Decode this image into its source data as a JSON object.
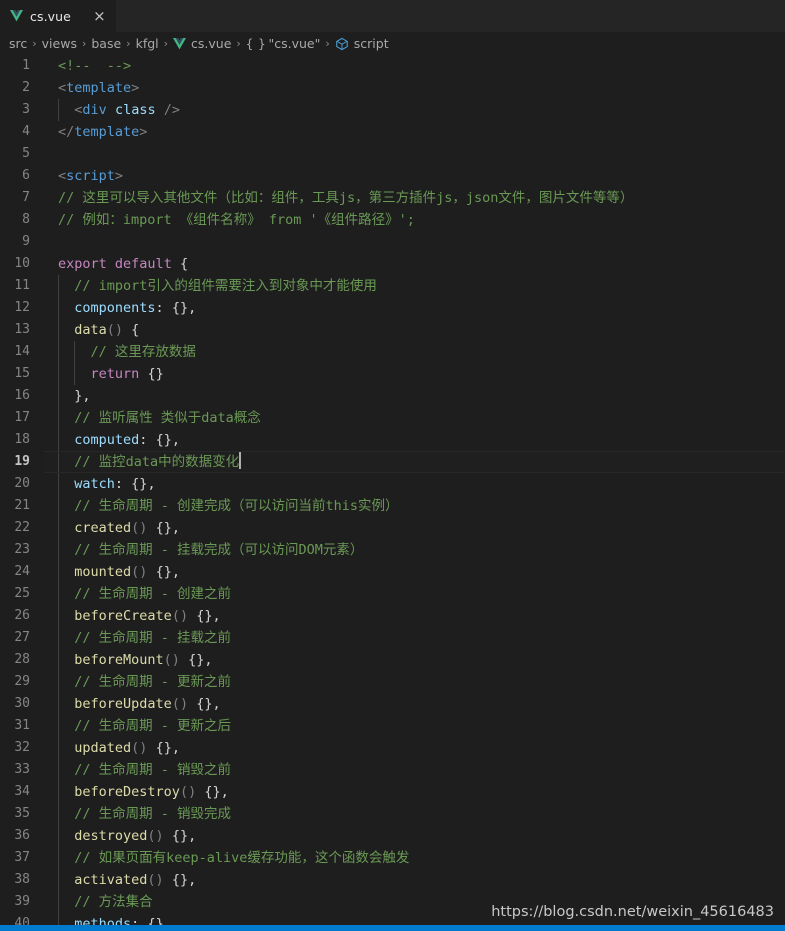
{
  "window": {
    "background": "#1e1e1e",
    "accent": "#007acc"
  },
  "tabbar": {
    "tabs": [
      {
        "label": "cs.vue",
        "icon": "vue-logo-icon",
        "active": true,
        "close_glyph": "×"
      }
    ]
  },
  "breadcrumb": {
    "separator": "›",
    "items": [
      {
        "label": "src",
        "icon": null
      },
      {
        "label": "views",
        "icon": null
      },
      {
        "label": "base",
        "icon": null
      },
      {
        "label": "kfgl",
        "icon": null
      },
      {
        "label": "cs.vue",
        "icon": "vue-logo-icon"
      },
      {
        "label": "\"cs.vue\"",
        "icon": "braces-icon"
      },
      {
        "label": "script",
        "icon": "symbol-cube-icon"
      }
    ]
  },
  "editor": {
    "language": "vue",
    "active_line": 19,
    "cursor_line": 19,
    "colors": {
      "comment": "#6a9955",
      "tag": "#569cd6",
      "keyword": "#c586c0",
      "property": "#9cdcfe",
      "function": "#dcdcaa",
      "punctuation": "#808080",
      "foreground": "#d4d4d4",
      "line_number": "#858585",
      "line_number_active": "#c6c6c6",
      "indent_guide": "#404040"
    },
    "lines": [
      {
        "n": 1,
        "indent": 0,
        "tokens": [
          {
            "t": "<!--  -->",
            "c": "c"
          }
        ]
      },
      {
        "n": 2,
        "indent": 0,
        "tokens": [
          {
            "t": "<",
            "c": "pun"
          },
          {
            "t": "template",
            "c": "tag"
          },
          {
            "t": ">",
            "c": "pun"
          }
        ]
      },
      {
        "n": 3,
        "indent": 1,
        "tokens": [
          {
            "t": "  ",
            "c": "br"
          },
          {
            "t": "<",
            "c": "pun"
          },
          {
            "t": "div",
            "c": "tag"
          },
          {
            "t": " ",
            "c": "br"
          },
          {
            "t": "class",
            "c": "attr"
          },
          {
            "t": " ",
            "c": "br"
          },
          {
            "t": "/>",
            "c": "pun"
          }
        ]
      },
      {
        "n": 4,
        "indent": 0,
        "tokens": [
          {
            "t": "</",
            "c": "pun"
          },
          {
            "t": "template",
            "c": "tag"
          },
          {
            "t": ">",
            "c": "pun"
          }
        ]
      },
      {
        "n": 5,
        "indent": 0,
        "tokens": []
      },
      {
        "n": 6,
        "indent": 0,
        "tokens": [
          {
            "t": "<",
            "c": "pun"
          },
          {
            "t": "script",
            "c": "tag"
          },
          {
            "t": ">",
            "c": "pun"
          }
        ]
      },
      {
        "n": 7,
        "indent": 0,
        "tokens": [
          {
            "t": "// 这里可以导入其他文件（比如：组件，工具js，第三方插件js，json文件，图片文件等等）",
            "c": "c"
          }
        ]
      },
      {
        "n": 8,
        "indent": 0,
        "tokens": [
          {
            "t": "// 例如：import 《组件名称》 from '《组件路径》';",
            "c": "c"
          }
        ]
      },
      {
        "n": 9,
        "indent": 0,
        "tokens": []
      },
      {
        "n": 10,
        "indent": 0,
        "tokens": [
          {
            "t": "export",
            "c": "kw"
          },
          {
            "t": " ",
            "c": "br"
          },
          {
            "t": "default",
            "c": "kw"
          },
          {
            "t": " {",
            "c": "br"
          }
        ]
      },
      {
        "n": 11,
        "indent": 1,
        "tokens": [
          {
            "t": "  ",
            "c": "br"
          },
          {
            "t": "// import引入的组件需要注入到对象中才能使用",
            "c": "c"
          }
        ]
      },
      {
        "n": 12,
        "indent": 1,
        "tokens": [
          {
            "t": "  ",
            "c": "br"
          },
          {
            "t": "components",
            "c": "attr"
          },
          {
            "t": ": ",
            "c": "br"
          },
          {
            "t": "{}",
            "c": "br"
          },
          {
            "t": ",",
            "c": "br"
          }
        ]
      },
      {
        "n": 13,
        "indent": 1,
        "tokens": [
          {
            "t": "  ",
            "c": "br"
          },
          {
            "t": "data",
            "c": "fn"
          },
          {
            "t": "()",
            "c": "pun"
          },
          {
            "t": " {",
            "c": "br"
          }
        ]
      },
      {
        "n": 14,
        "indent": 2,
        "tokens": [
          {
            "t": "    ",
            "c": "br"
          },
          {
            "t": "// 这里存放数据",
            "c": "c"
          }
        ]
      },
      {
        "n": 15,
        "indent": 2,
        "tokens": [
          {
            "t": "    ",
            "c": "br"
          },
          {
            "t": "return",
            "c": "kw"
          },
          {
            "t": " ",
            "c": "br"
          },
          {
            "t": "{}",
            "c": "br"
          }
        ]
      },
      {
        "n": 16,
        "indent": 1,
        "tokens": [
          {
            "t": "  ",
            "c": "br"
          },
          {
            "t": "},",
            "c": "br"
          }
        ]
      },
      {
        "n": 17,
        "indent": 1,
        "tokens": [
          {
            "t": "  ",
            "c": "br"
          },
          {
            "t": "// 监听属性 类似于data概念",
            "c": "c"
          }
        ]
      },
      {
        "n": 18,
        "indent": 1,
        "tokens": [
          {
            "t": "  ",
            "c": "br"
          },
          {
            "t": "computed",
            "c": "attr"
          },
          {
            "t": ": ",
            "c": "br"
          },
          {
            "t": "{}",
            "c": "br"
          },
          {
            "t": ",",
            "c": "br"
          }
        ]
      },
      {
        "n": 19,
        "indent": 1,
        "tokens": [
          {
            "t": "  ",
            "c": "br"
          },
          {
            "t": "// 监控data中的数据变化",
            "c": "c"
          }
        ],
        "cursor": true
      },
      {
        "n": 20,
        "indent": 1,
        "tokens": [
          {
            "t": "  ",
            "c": "br"
          },
          {
            "t": "watch",
            "c": "attr"
          },
          {
            "t": ": ",
            "c": "br"
          },
          {
            "t": "{}",
            "c": "br"
          },
          {
            "t": ",",
            "c": "br"
          }
        ]
      },
      {
        "n": 21,
        "indent": 1,
        "tokens": [
          {
            "t": "  ",
            "c": "br"
          },
          {
            "t": "// 生命周期 - 创建完成（可以访问当前this实例）",
            "c": "c"
          }
        ]
      },
      {
        "n": 22,
        "indent": 1,
        "tokens": [
          {
            "t": "  ",
            "c": "br"
          },
          {
            "t": "created",
            "c": "fn"
          },
          {
            "t": "()",
            "c": "pun"
          },
          {
            "t": " {},",
            "c": "br"
          }
        ]
      },
      {
        "n": 23,
        "indent": 1,
        "tokens": [
          {
            "t": "  ",
            "c": "br"
          },
          {
            "t": "// 生命周期 - 挂载完成（可以访问DOM元素）",
            "c": "c"
          }
        ]
      },
      {
        "n": 24,
        "indent": 1,
        "tokens": [
          {
            "t": "  ",
            "c": "br"
          },
          {
            "t": "mounted",
            "c": "fn"
          },
          {
            "t": "()",
            "c": "pun"
          },
          {
            "t": " {},",
            "c": "br"
          }
        ]
      },
      {
        "n": 25,
        "indent": 1,
        "tokens": [
          {
            "t": "  ",
            "c": "br"
          },
          {
            "t": "// 生命周期 - 创建之前",
            "c": "c"
          }
        ]
      },
      {
        "n": 26,
        "indent": 1,
        "tokens": [
          {
            "t": "  ",
            "c": "br"
          },
          {
            "t": "beforeCreate",
            "c": "fn"
          },
          {
            "t": "()",
            "c": "pun"
          },
          {
            "t": " {},",
            "c": "br"
          }
        ]
      },
      {
        "n": 27,
        "indent": 1,
        "tokens": [
          {
            "t": "  ",
            "c": "br"
          },
          {
            "t": "// 生命周期 - 挂载之前",
            "c": "c"
          }
        ]
      },
      {
        "n": 28,
        "indent": 1,
        "tokens": [
          {
            "t": "  ",
            "c": "br"
          },
          {
            "t": "beforeMount",
            "c": "fn"
          },
          {
            "t": "()",
            "c": "pun"
          },
          {
            "t": " {},",
            "c": "br"
          }
        ]
      },
      {
        "n": 29,
        "indent": 1,
        "tokens": [
          {
            "t": "  ",
            "c": "br"
          },
          {
            "t": "// 生命周期 - 更新之前",
            "c": "c"
          }
        ]
      },
      {
        "n": 30,
        "indent": 1,
        "tokens": [
          {
            "t": "  ",
            "c": "br"
          },
          {
            "t": "beforeUpdate",
            "c": "fn"
          },
          {
            "t": "()",
            "c": "pun"
          },
          {
            "t": " {},",
            "c": "br"
          }
        ]
      },
      {
        "n": 31,
        "indent": 1,
        "tokens": [
          {
            "t": "  ",
            "c": "br"
          },
          {
            "t": "// 生命周期 - 更新之后",
            "c": "c"
          }
        ]
      },
      {
        "n": 32,
        "indent": 1,
        "tokens": [
          {
            "t": "  ",
            "c": "br"
          },
          {
            "t": "updated",
            "c": "fn"
          },
          {
            "t": "()",
            "c": "pun"
          },
          {
            "t": " {},",
            "c": "br"
          }
        ]
      },
      {
        "n": 33,
        "indent": 1,
        "tokens": [
          {
            "t": "  ",
            "c": "br"
          },
          {
            "t": "// 生命周期 - 销毁之前",
            "c": "c"
          }
        ]
      },
      {
        "n": 34,
        "indent": 1,
        "tokens": [
          {
            "t": "  ",
            "c": "br"
          },
          {
            "t": "beforeDestroy",
            "c": "fn"
          },
          {
            "t": "()",
            "c": "pun"
          },
          {
            "t": " {},",
            "c": "br"
          }
        ]
      },
      {
        "n": 35,
        "indent": 1,
        "tokens": [
          {
            "t": "  ",
            "c": "br"
          },
          {
            "t": "// 生命周期 - 销毁完成",
            "c": "c"
          }
        ]
      },
      {
        "n": 36,
        "indent": 1,
        "tokens": [
          {
            "t": "  ",
            "c": "br"
          },
          {
            "t": "destroyed",
            "c": "fn"
          },
          {
            "t": "()",
            "c": "pun"
          },
          {
            "t": " {},",
            "c": "br"
          }
        ]
      },
      {
        "n": 37,
        "indent": 1,
        "tokens": [
          {
            "t": "  ",
            "c": "br"
          },
          {
            "t": "// 如果页面有keep-alive缓存功能，这个函数会触发",
            "c": "c"
          }
        ]
      },
      {
        "n": 38,
        "indent": 1,
        "tokens": [
          {
            "t": "  ",
            "c": "br"
          },
          {
            "t": "activated",
            "c": "fn"
          },
          {
            "t": "()",
            "c": "pun"
          },
          {
            "t": " {},",
            "c": "br"
          }
        ]
      },
      {
        "n": 39,
        "indent": 1,
        "tokens": [
          {
            "t": "  ",
            "c": "br"
          },
          {
            "t": "// 方法集合",
            "c": "c"
          }
        ]
      },
      {
        "n": 40,
        "indent": 1,
        "tokens": [
          {
            "t": "  ",
            "c": "br"
          },
          {
            "t": "methods",
            "c": "attr"
          },
          {
            "t": ": ",
            "c": "br"
          },
          {
            "t": "{}",
            "c": "br"
          }
        ]
      }
    ]
  },
  "watermark": {
    "text": "https://blog.csdn.net/weixin_45616483"
  }
}
